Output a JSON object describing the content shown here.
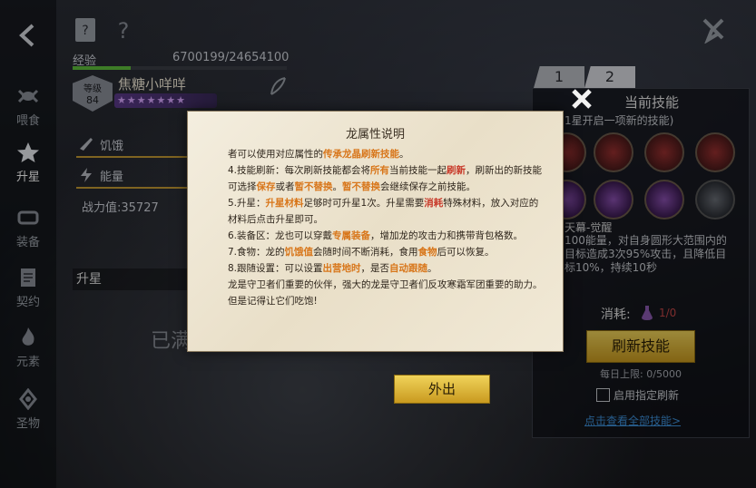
{
  "sidebar": {
    "items": [
      {
        "label": "喂食",
        "icon": "candy-icon"
      },
      {
        "label": "升星",
        "icon": "star-icon"
      },
      {
        "label": "装备",
        "icon": "equip-icon"
      },
      {
        "label": "契约",
        "icon": "contract-icon"
      },
      {
        "label": "元素",
        "icon": "flame-icon"
      },
      {
        "label": "圣物",
        "icon": "relic-icon"
      }
    ]
  },
  "hero": {
    "exp_label": "经验",
    "exp_value": "6700199/24654100",
    "exp_progress": 0.27,
    "level_label": "等级",
    "level": "84",
    "name": "焦糖小咩咩",
    "stars": "★★★★★★★",
    "hunger_label": "饥饿",
    "energy_label": "能量",
    "power": "战力值:35727",
    "upstar_label": "升星",
    "full_text": "已满"
  },
  "right_panel": {
    "tabs": [
      "1",
      "2"
    ],
    "title": "当前技能",
    "subtitle": "1星开启一项新的技能)",
    "skill_name": "天幕-觉醒",
    "skill_desc": "100能量，对自身圆形大范围内的目标造成3次95%攻击，且降低目标10%，持续10秒",
    "cost_label": "消耗:",
    "cost_value": "1/0",
    "refresh_button": "刷新技能",
    "daily_limit": "每日上限: 0/5000",
    "checkbox_label": "启用指定刷新",
    "view_all": "点击查看全部技能>"
  },
  "dialog": {
    "title": "龙属性说明",
    "line0_a": "者可以使用对应属性的",
    "line0_b": "传承龙晶刷新技能",
    "line0_c": "。",
    "l4_a": "4.技能刷新：每次刷新技能都会将",
    "l4_b": "所有",
    "l4_c": "当前技能一起",
    "l4_d": "刷新",
    "l4_e": "，刷新出的新技能可选择",
    "l4_f": "保存",
    "l4_g": "或者",
    "l4_h": "暂不替换",
    "l4_i": "。",
    "l4_j": "暂不替换",
    "l4_k": "会继续保存之前技能。",
    "l5_a": "5.升星：",
    "l5_b": "升星材料",
    "l5_c": "足够时可升星1次。升星需要",
    "l5_d": "消耗",
    "l5_e": "特殊材料，放入对应的材料后点击升星即可。",
    "l6_a": "6.装备区：龙也可以穿戴",
    "l6_b": "专属装备",
    "l6_c": "，增加龙的攻击力和携带背包格数",
    "l6_d": "。",
    "l7_a": "7.食物：龙的",
    "l7_b": "饥饿值",
    "l7_c": "会随时间不断消耗，食用",
    "l7_d": "食物",
    "l7_e": "后可以恢复。",
    "l8_a": "8.跟随设置：可以设置",
    "l8_b": "出营地时",
    "l8_c": "，是否",
    "l8_d": "自动跟随",
    "l8_e": "。",
    "l9": "龙是守卫者们重要的伙伴，强大的龙是守卫者们反攻寒霜军团重要的助力。但是记得让它们吃饱!",
    "exit_button": "外出"
  }
}
